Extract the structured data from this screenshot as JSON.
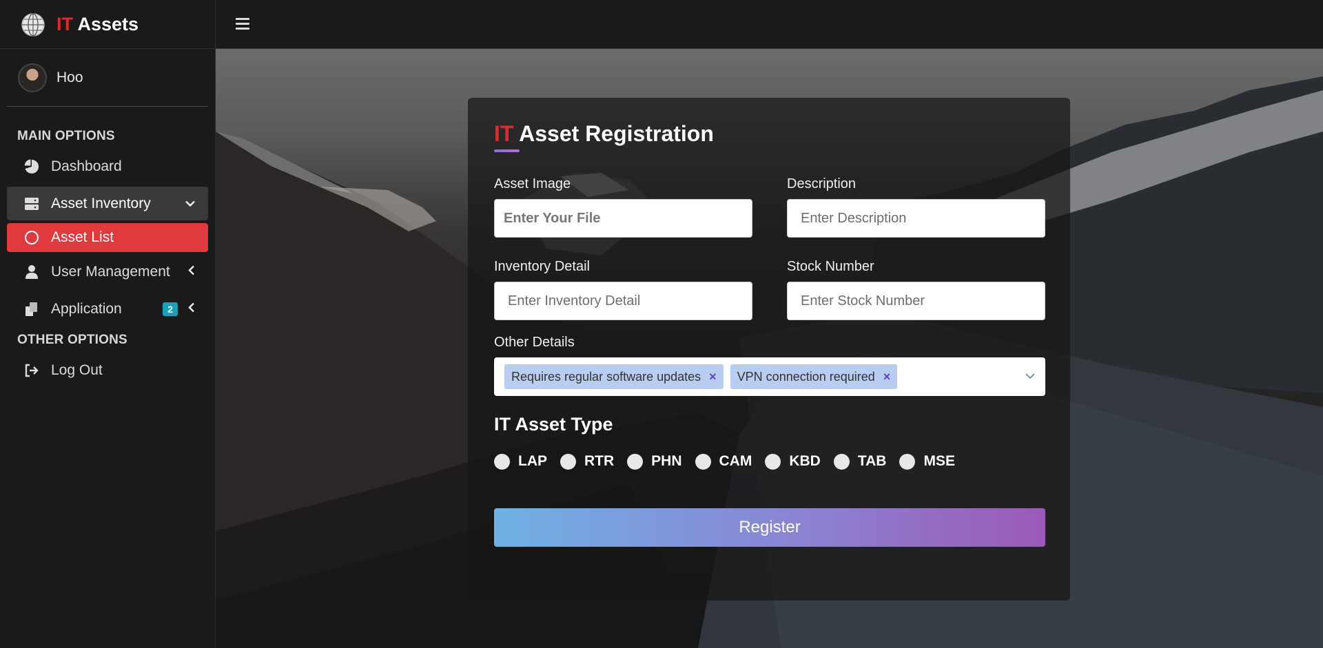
{
  "app": {
    "title_prefix": "IT",
    "title_rest": "Assets"
  },
  "user": {
    "name": "Hoo"
  },
  "sidebar": {
    "sections": [
      {
        "title": "MAIN OPTIONS"
      },
      {
        "title": "OTHER OPTIONS"
      }
    ],
    "items": [
      {
        "label": "Dashboard",
        "icon": "pie-chart-icon"
      },
      {
        "label": "Asset Inventory",
        "icon": "server-icon",
        "expanded": true
      },
      {
        "label": "Asset List",
        "icon": "circle-icon",
        "active": true
      },
      {
        "label": "User Management",
        "icon": "user-icon"
      },
      {
        "label": "Application",
        "icon": "copy-icon",
        "badge": "2"
      },
      {
        "label": "Log Out",
        "icon": "logout-icon"
      }
    ]
  },
  "form": {
    "title_prefix": "IT",
    "title_rest": "Asset Registration",
    "asset_image": {
      "label": "Asset Image",
      "placeholder": "Enter Your File"
    },
    "description": {
      "label": "Description",
      "placeholder": "Enter Description"
    },
    "inventory_detail": {
      "label": "Inventory Detail",
      "placeholder": "Enter Inventory Detail"
    },
    "stock_number": {
      "label": "Stock Number",
      "placeholder": "Enter Stock Number"
    },
    "other_details": {
      "label": "Other Details",
      "tags": [
        "Requires regular software updates",
        "VPN connection required"
      ],
      "remove_glyph": "×"
    },
    "asset_type": {
      "title": "IT Asset Type",
      "options": [
        "LAP",
        "RTR",
        "PHN",
        "CAM",
        "KBD",
        "TAB",
        "MSE"
      ]
    },
    "register_label": "Register"
  },
  "colors": {
    "accent_red": "#e8262b",
    "badge": "#17a2b8",
    "active_item": "#e03a3e"
  }
}
